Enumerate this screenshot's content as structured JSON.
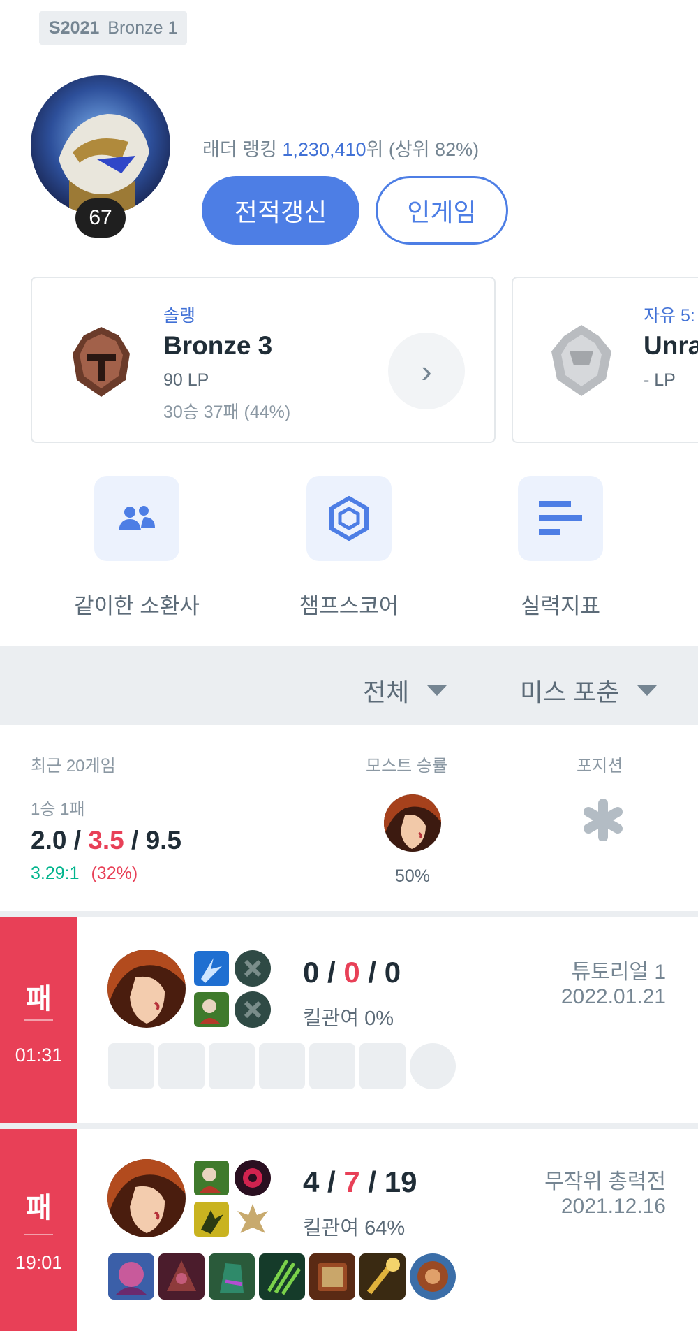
{
  "profile": {
    "season": "S2021",
    "season_tier": "Bronze 1",
    "level": "67",
    "ladder_label": "래더 랭킹",
    "ladder_rank": "1,230,410",
    "ladder_suffix": "위",
    "ladder_top": "(상위 82%)",
    "refresh_button": "전적갱신",
    "ingame_button": "인게임"
  },
  "ranks": [
    {
      "queue": "솔랭",
      "tier": "Bronze 3",
      "lp": "90 LP",
      "record": "30승 37패 (44%)"
    },
    {
      "queue": "자유 5:",
      "tier": "Unra",
      "lp": "- LP"
    }
  ],
  "quick_links": [
    {
      "label": "같이한 소환사",
      "icon": "people-icon"
    },
    {
      "label": "챔프스코어",
      "icon": "hexagon-target-icon"
    },
    {
      "label": "실력지표",
      "icon": "bars-icon"
    }
  ],
  "filters": {
    "queue_filter": "전체",
    "champion_filter": "미스 포춘"
  },
  "summary": {
    "recent_label": "최근 20게임",
    "record": "1승 1패",
    "kills": "2.0",
    "deaths": "3.5",
    "assists": "9.5",
    "kda_ratio": "3.29:1",
    "kill_participation": "(32%)",
    "most_winrate_label": "모스트 승률",
    "most_winrate_value": "50%",
    "position_label": "포지션",
    "slash": "/"
  },
  "matches": [
    {
      "result": "패",
      "duration": "01:31",
      "kills": "0",
      "deaths": "0",
      "assists": "0",
      "kill_participation": "킬관여 0%",
      "mode": "튜토리얼 1",
      "date": "2022.01.21"
    },
    {
      "result": "패",
      "duration": "19:01",
      "kills": "4",
      "deaths": "7",
      "assists": "19",
      "kill_participation": "킬관여 64%",
      "mode": "무작위 총력전",
      "date": "2021.12.16"
    }
  ],
  "colors": {
    "accent": "#4d7ee5",
    "loss": "#e84057",
    "positive": "#00b48c",
    "surface": "#ebeef1"
  }
}
